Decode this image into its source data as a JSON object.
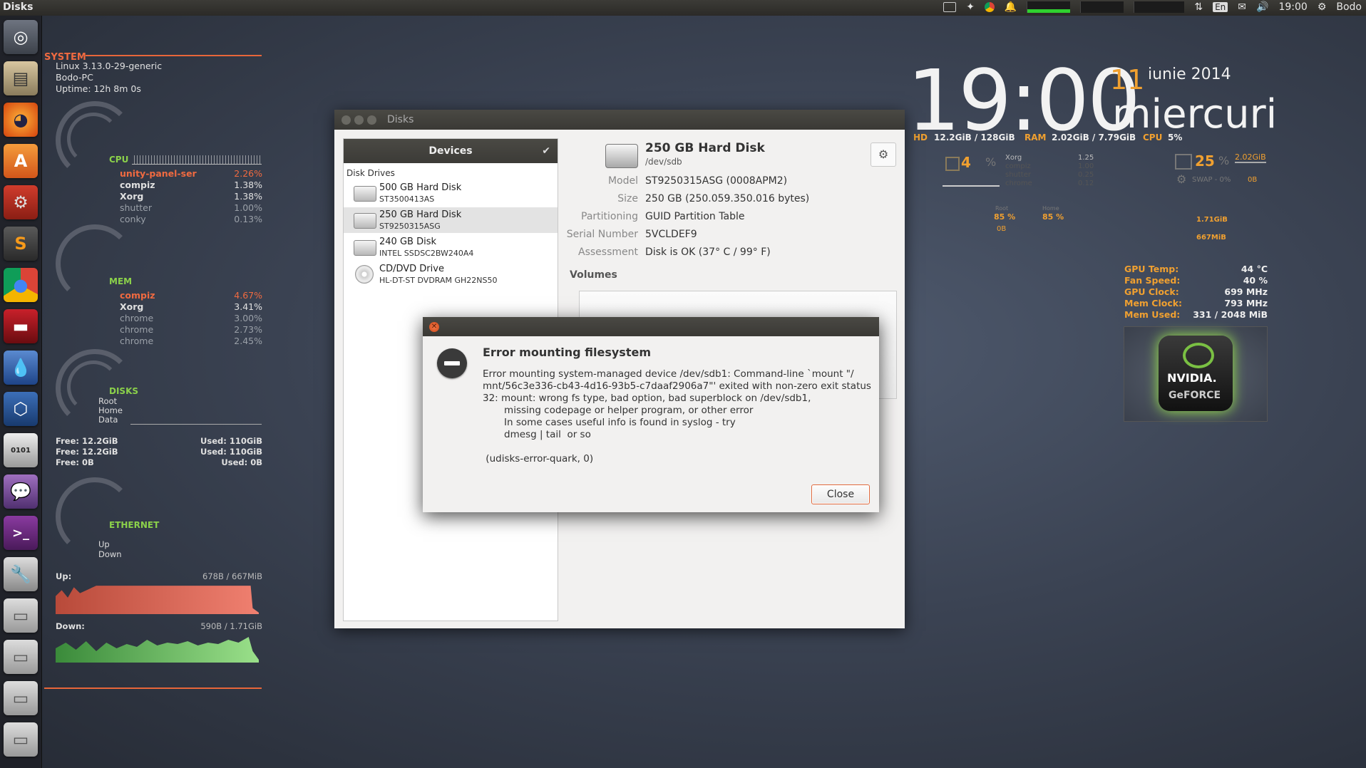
{
  "topbar": {
    "app_title": "Disks",
    "tray_lang": "En",
    "tray_time": "19:00",
    "tray_user": "Bodo"
  },
  "launcher": {
    "items": [
      "dash-icon",
      "files-icon",
      "firefox-icon",
      "software-center-icon",
      "settings-icon",
      "sublime-icon",
      "chrome-icon",
      "terminal-red-icon",
      "drop-icon",
      "virtualbox-icon",
      "binary-editor-icon",
      "pidgin-icon",
      "terminal-icon",
      "disk-utility-icon",
      "drive-icon",
      "drive-icon",
      "drive-icon",
      "drive-icon"
    ]
  },
  "conky": {
    "system_head": "SYSTEM",
    "kernel": "Linux 3.13.0-29-generic",
    "host": "Bodo-PC",
    "uptime": "Uptime: 12h 8m 0s",
    "cpu_label": "CPU",
    "cpu_procs": [
      {
        "name": "unity-panel-ser",
        "value": "2.26%"
      },
      {
        "name": "compiz",
        "value": "1.38%"
      },
      {
        "name": "Xorg",
        "value": "1.38%"
      },
      {
        "name": "shutter",
        "value": "1.00%"
      },
      {
        "name": "conky",
        "value": "0.13%"
      }
    ],
    "mem_label": "MEM",
    "mem_procs": [
      {
        "name": "compiz",
        "value": "4.67%"
      },
      {
        "name": "Xorg",
        "value": "3.41%"
      },
      {
        "name": "chrome",
        "value": "3.00%"
      },
      {
        "name": "chrome",
        "value": "2.73%"
      },
      {
        "name": "chrome",
        "value": "2.45%"
      }
    ],
    "disks_label": "DISKS",
    "disk_names": [
      "Root",
      "Home",
      "Data"
    ],
    "disk_free": [
      "Free: 12.2GiB",
      "Free: 12.2GiB",
      "Free: 0B"
    ],
    "disk_used": [
      "Used: 110GiB",
      "Used: 110GiB",
      "Used: 0B"
    ],
    "eth_label": "ETHERNET",
    "eth_up": "Up",
    "eth_down": "Down",
    "up_label": "Up:",
    "up_value": "678B  / 667MiB",
    "down_label": "Down:",
    "down_value": "590B  / 1.71GiB",
    "gauge_ticks": [
      "1",
      "15",
      "25",
      "0.1",
      "0.6"
    ]
  },
  "clock": {
    "time": "19:00",
    "day": "11",
    "month_year": "iunie 2014",
    "weekday": "miercuri",
    "hd_label": "HD",
    "hd_value": "12.2GiB / 128GiB",
    "ram_label": "RAM",
    "ram_value": "2.02GiB / 7.79GiB",
    "cpu_label": "CPU",
    "cpu_value": "5%"
  },
  "right_conky": {
    "cpu_big": "4",
    "cpu_unit": "%",
    "procs": [
      {
        "name": "Xorg",
        "value": "1.25"
      },
      {
        "name": "compiz",
        "value": "1.00"
      },
      {
        "name": "shutter",
        "value": "0.25"
      },
      {
        "name": "chrome",
        "value": "0.12"
      }
    ],
    "mem_big": "25",
    "mem_unit": "%",
    "mem_value": "2.02GiB",
    "swap": "SWAP -  0%",
    "swap_val": "0B",
    "root_pct": "85 %",
    "home_pct": "85 %",
    "root_label": "Root",
    "home_label": "Home",
    "disk_zero": "0B",
    "down_val": "1.71GiB",
    "up_val": "667MiB"
  },
  "gpu": {
    "labels": [
      "GPU Temp:",
      "Fan Speed:",
      "GPU Clock:",
      "Mem Clock:",
      "Mem Used:"
    ],
    "values": [
      "44 °C",
      "40 %",
      "699 MHz",
      "793 MHz",
      "331 / 2048 MiB"
    ],
    "logo_text": "NVIDIA.",
    "logo_sub": "GeFORCE"
  },
  "disks_window": {
    "title": "Disks",
    "devices_header": "Devices",
    "section": "Disk Drives",
    "devices": [
      {
        "name": "500 GB Hard Disk",
        "sub": "ST3500413AS"
      },
      {
        "name": "250 GB Hard Disk",
        "sub": "ST9250315ASG"
      },
      {
        "name": "240 GB Disk",
        "sub": "INTEL SSDSC2BW240A4"
      },
      {
        "name": "CD/DVD Drive",
        "sub": "HL-DT-ST DVDRAM GH22NS50"
      }
    ],
    "disk_title": "250 GB Hard Disk",
    "disk_path": "/dev/sdb",
    "fields": [
      {
        "label": "Model",
        "value": "ST9250315ASG (0008APM2)"
      },
      {
        "label": "Size",
        "value": "250 GB (250.059.350.016 bytes)"
      },
      {
        "label": "Partitioning",
        "value": "GUID Partition Table"
      },
      {
        "label": "Serial Number",
        "value": "5VCLDEF9"
      },
      {
        "label": "Assessment",
        "value": "Disk is OK (37° C / 99° F)"
      }
    ],
    "volumes_label": "Volumes"
  },
  "dialog": {
    "heading": "Error mounting filesystem",
    "message": "Error mounting system-managed device /dev/sdb1: Command-line `mount \"/\nmnt/56c3e336-cb43-4d16-93b5-c7daaf2906a7\"' exited with non-zero exit status\n32: mount: wrong fs type, bad option, bad superblock on /dev/sdb1,\n       missing codepage or helper program, or other error\n       In some cases useful info is found in syslog - try\n       dmesg | tail  or so\n\n (udisks-error-quark, 0)",
    "close_label": "Close"
  }
}
